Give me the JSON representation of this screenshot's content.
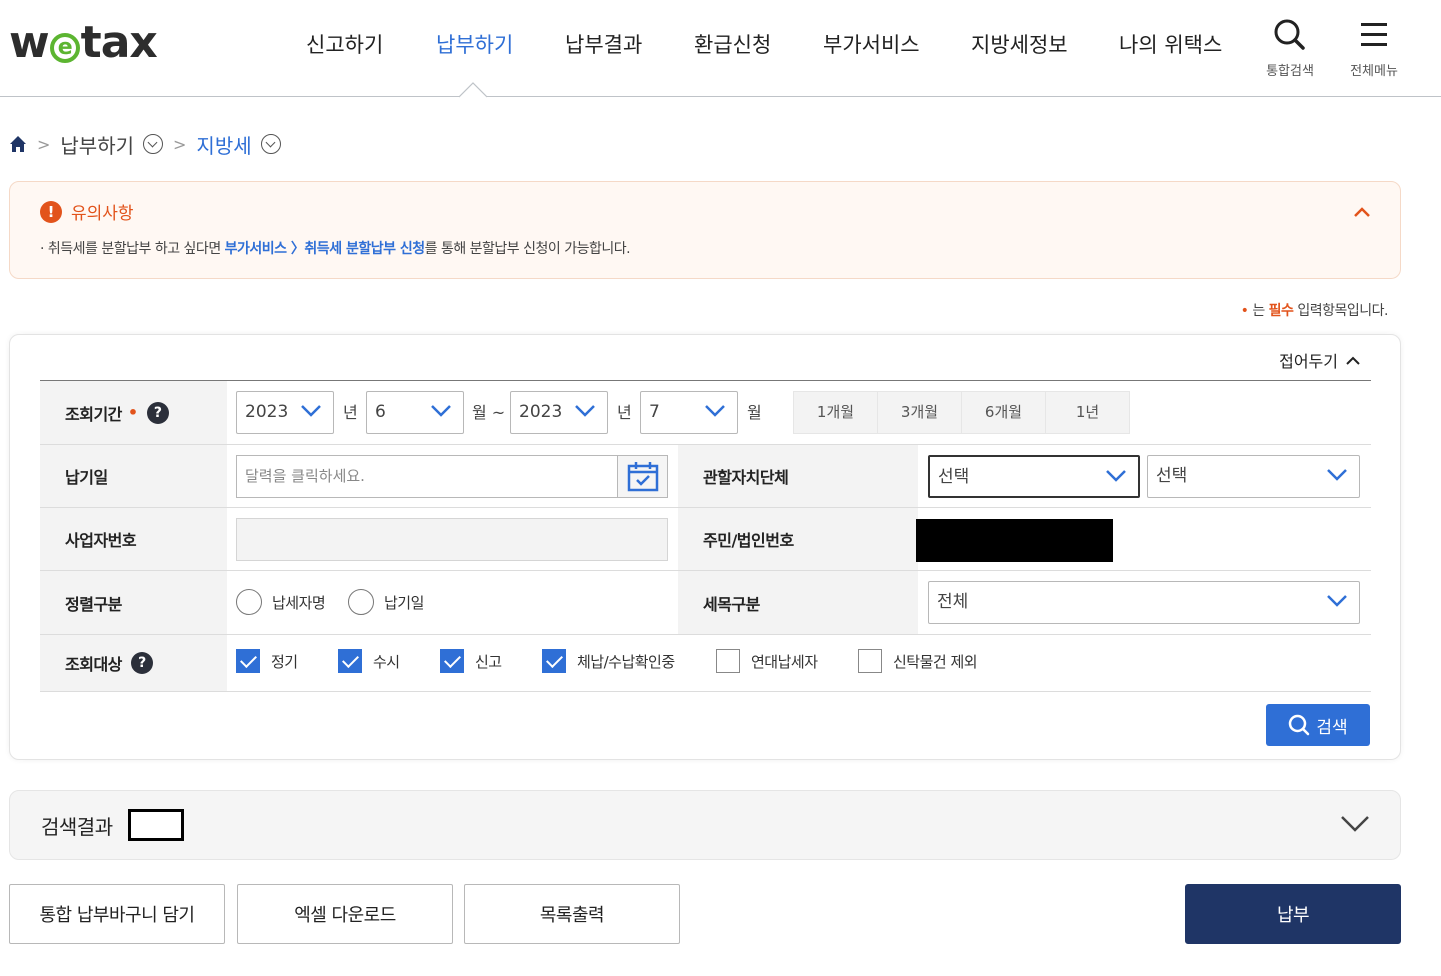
{
  "header": {
    "logo": {
      "pre": "w",
      "mid": "e",
      "post": "tax"
    },
    "nav": [
      {
        "label": "신고하기",
        "active": false
      },
      {
        "label": "납부하기",
        "active": true
      },
      {
        "label": "납부결과",
        "active": false
      },
      {
        "label": "환급신청",
        "active": false
      },
      {
        "label": "부가서비스",
        "active": false
      },
      {
        "label": "지방세정보",
        "active": false
      },
      {
        "label": "나의 위택스",
        "active": false
      }
    ],
    "search_label": "통합검색",
    "menu_label": "전체메뉴"
  },
  "breadcrumb": {
    "level1": "납부하기",
    "level2": "지방세"
  },
  "notice": {
    "title": "유의사항",
    "bullet": "·",
    "text_pre": "취득세를 분할납부 하고 싶다면 ",
    "link": "부가서비스 〉취득세 분할납부 신청",
    "text_post": "를 통해 분할납부 신청이 가능합니다."
  },
  "required_note": {
    "dot": "•",
    "pre": "는 ",
    "must": "필수",
    "post": " 입력항목입니다."
  },
  "form": {
    "fold_label": "접어두기",
    "period": {
      "label": "조회기간",
      "from_year": "2023",
      "from_month": "6",
      "to_year": "2023",
      "to_month": "7",
      "year_unit": "년",
      "month_unit_tilde": "월 ~",
      "month_unit": "월",
      "quick": [
        "1개월",
        "3개월",
        "6개월",
        "1년"
      ]
    },
    "pay_date": {
      "label": "납기일",
      "placeholder": "달력을 클릭하세요."
    },
    "region": {
      "label": "관할자치단체",
      "sido": "선택",
      "sigungu": "선택"
    },
    "biz_no": {
      "label": "사업자번호"
    },
    "resident_no": {
      "label": "주민/법인번호"
    },
    "sort": {
      "label": "정렬구분",
      "options": [
        "납세자명",
        "납기일"
      ]
    },
    "tax_item": {
      "label": "세목구분",
      "value": "전체"
    },
    "target": {
      "label": "조회대상",
      "options": [
        {
          "label": "정기",
          "checked": true
        },
        {
          "label": "수시",
          "checked": true
        },
        {
          "label": "신고",
          "checked": true
        },
        {
          "label": "체납/수납확인중",
          "checked": true
        },
        {
          "label": "연대납세자",
          "checked": false
        },
        {
          "label": "신탁물건 제외",
          "checked": false
        }
      ]
    },
    "search_button": "검색"
  },
  "results": {
    "title": "검색결과"
  },
  "buttons": {
    "cart": "통합 납부바구니 담기",
    "excel": "엑셀 다운로드",
    "print": "목록출력",
    "pay": "납부"
  },
  "colors": {
    "accent": "#2f6fd6",
    "warning": "#e2531b",
    "primary_button": "#1f3566",
    "logo_green": "#5cb531"
  }
}
